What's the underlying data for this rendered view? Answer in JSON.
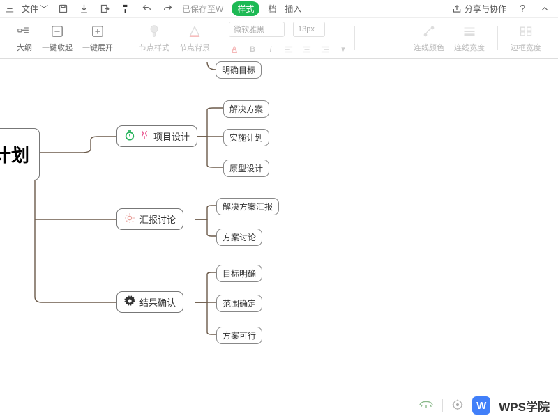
{
  "menubar": {
    "file_label": "文件",
    "save_status": "已保存至W",
    "tab_style": "样式",
    "tab_doc": "档",
    "tab_insert": "插入",
    "share_label": "分享与协作"
  },
  "toolbar": {
    "outline": "大纲",
    "collapse_all": "一键收起",
    "expand_all": "一键展开",
    "node_style": "节点样式",
    "node_bg": "节点背景",
    "font_name": "微软雅黑",
    "font_size": "13px",
    "line_color": "连线颜色",
    "line_width": "连线宽度",
    "border_width": "边框宽度"
  },
  "mindmap": {
    "root": "计划",
    "branches": [
      {
        "icons": [
          "timer-green",
          "drop-pink"
        ],
        "label": "项目设计",
        "children": [
          "解决方案",
          "实施计划",
          "原型设计"
        ]
      },
      {
        "icons": [
          "bulb"
        ],
        "label": "汇报讨论",
        "children": [
          "解决方案汇报",
          "方案讨论"
        ]
      },
      {
        "icons": [
          "gear"
        ],
        "label": "结果确认",
        "children": [
          "目标明确",
          "范围确定",
          "方案可行"
        ]
      }
    ],
    "stray_child": "明确目标"
  },
  "footer": {
    "brand": "WPS学院"
  }
}
